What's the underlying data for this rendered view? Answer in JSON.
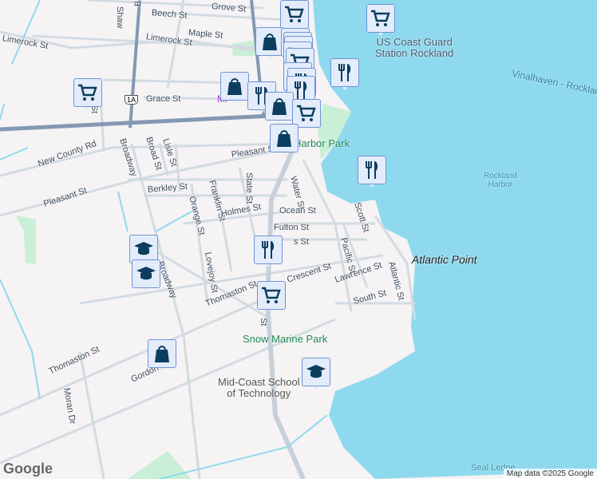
{
  "colors": {
    "water": "#8fd9ee",
    "land": "#f5f3f4",
    "park": "#c9efd6",
    "road": "#cfd8e0",
    "highway": "#8498b3",
    "marker": "#0b3d5e"
  },
  "streets": [
    "Grove St",
    "Beech St",
    "Maple St",
    "Limerock St",
    "Limerock St",
    "Shaw",
    "Broad",
    "Grace St",
    "Ma",
    "High St",
    "New County Rd",
    "Broadway",
    "Lisle St",
    "Broad St",
    "Pleasant St",
    "Pleasant St",
    "Berkley St",
    "Orange St",
    "Franklin St",
    "State St",
    "Water St",
    "Holmes St",
    "Ocean St",
    "Fulton St",
    "s St",
    "Lovejoy St",
    "Broadway",
    "Thomaston St",
    "Crescent St",
    "Lawrence St",
    "Pacific St",
    "Scott St",
    "Atlantic St",
    "South St",
    "St",
    "Thomaston St",
    "Gordon Dr",
    "Moran Dr"
  ],
  "route_shield": "1A",
  "places": {
    "coast_guard": "US Coast Guard\nStation Rockland",
    "harbor_park": "Harbor Park",
    "rockland_harbor": "Rockland\nHarbor",
    "ferry": "Vinalhaven - Rockland",
    "atlantic_point": "Atlantic Point",
    "snow_marine": "Snow Marine Park",
    "midcoast": "Mid-Coast School\nof Technology",
    "seal_ledge": "Seal Ledge",
    "mi": "Mi"
  },
  "markers": [
    "cart",
    "cart",
    "bag",
    "cart",
    "cart",
    "cart",
    "cart",
    "cart",
    "fork",
    "fork",
    "fork",
    "bag",
    "fork",
    "cart",
    "fork",
    "bag",
    "cart",
    "bag",
    "fork",
    "grad",
    "grad",
    "fork",
    "cart",
    "bag",
    "grad"
  ],
  "attribution": "Map data ©2025 Google",
  "logo": "Google"
}
